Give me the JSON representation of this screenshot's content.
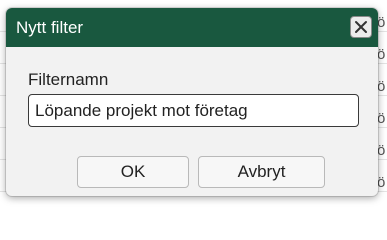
{
  "background": {
    "column_glyphs": [
      "ö",
      "ö",
      "ö",
      "ö",
      "ö",
      "ö"
    ]
  },
  "dialog": {
    "title": "Nytt filter",
    "close_icon": "close-icon",
    "field_label": "Filternamn",
    "field_value": "Löpande projekt mot företag",
    "ok_label": "OK",
    "cancel_label": "Avbryt"
  },
  "colors": {
    "titlebar": "#19583f",
    "dialog_bg": "#f2f2f2"
  }
}
